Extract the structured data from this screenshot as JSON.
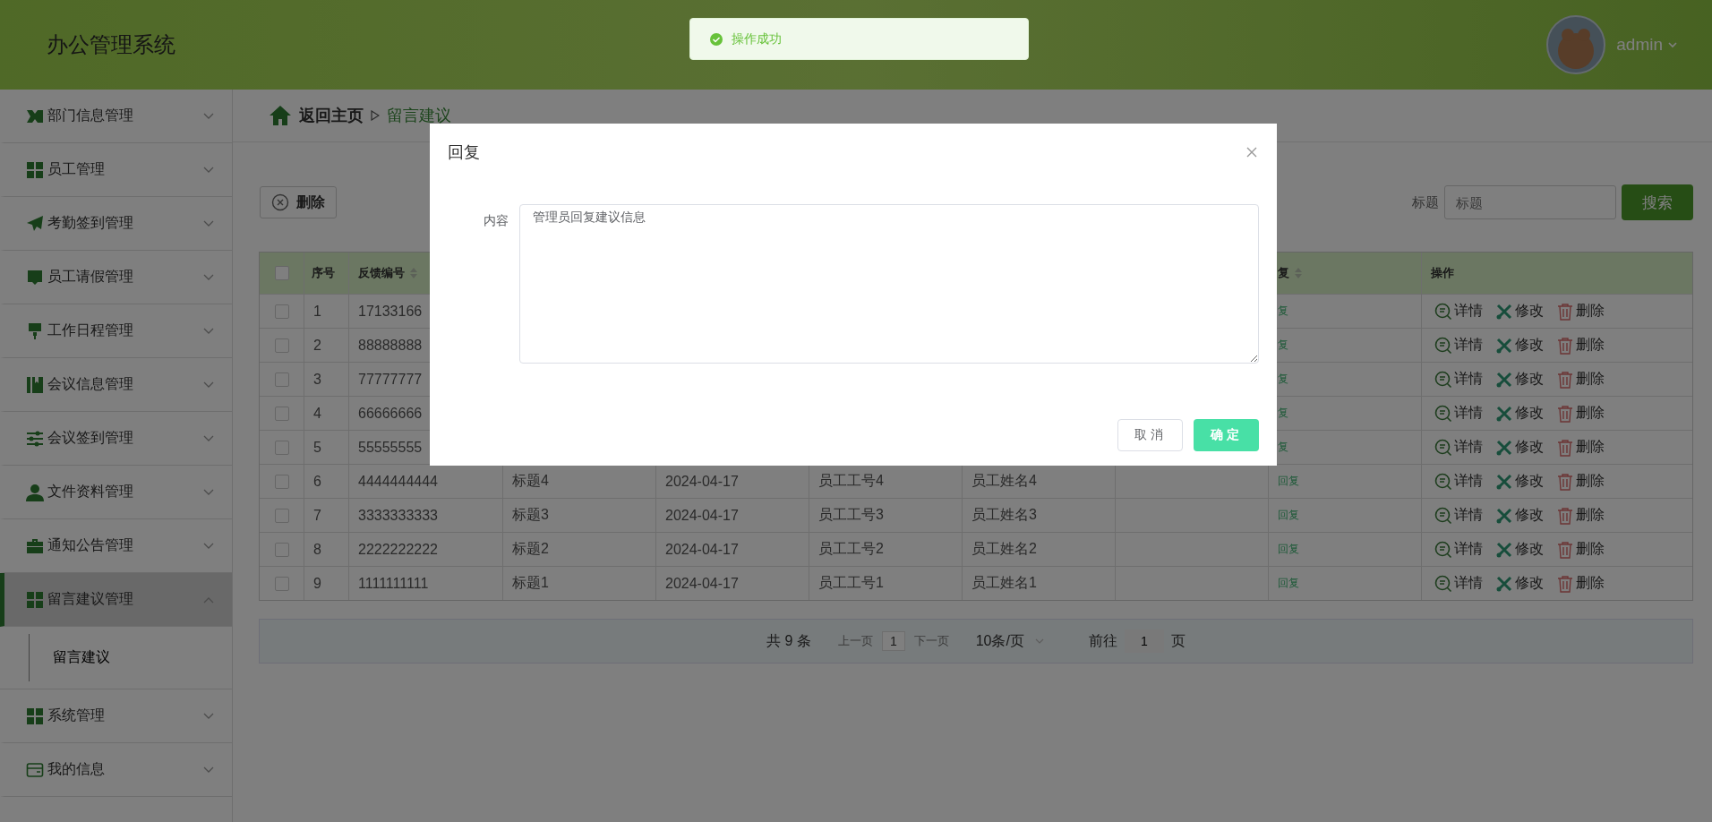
{
  "header": {
    "title": "办公管理系统",
    "user": "admin"
  },
  "toast": {
    "message": "操作成功"
  },
  "sidebar": {
    "items": [
      {
        "label": "部门信息管理",
        "expanded": false,
        "selected": false
      },
      {
        "label": "员工管理",
        "expanded": false,
        "selected": false
      },
      {
        "label": "考勤签到管理",
        "expanded": false,
        "selected": false
      },
      {
        "label": "员工请假管理",
        "expanded": false,
        "selected": false
      },
      {
        "label": "工作日程管理",
        "expanded": false,
        "selected": false
      },
      {
        "label": "会议信息管理",
        "expanded": false,
        "selected": false
      },
      {
        "label": "会议签到管理",
        "expanded": false,
        "selected": false
      },
      {
        "label": "文件资料管理",
        "expanded": false,
        "selected": false
      },
      {
        "label": "通知公告管理",
        "expanded": false,
        "selected": false
      },
      {
        "label": "留言建议管理",
        "expanded": true,
        "selected": true,
        "children": [
          {
            "label": "留言建议",
            "selected": true
          }
        ]
      },
      {
        "label": "系统管理",
        "expanded": false,
        "selected": false
      },
      {
        "label": "我的信息",
        "expanded": false,
        "selected": false
      }
    ]
  },
  "breadcrumb": {
    "home": "返回主页",
    "current": "留言建议"
  },
  "toolbar": {
    "delete_button": "删除",
    "search_label": "标题",
    "search_placeholder": "标题",
    "search_button": "搜索"
  },
  "table": {
    "select_all": {
      "checked": false
    },
    "columns": [
      {
        "label": "序号",
        "kind": "text"
      },
      {
        "label": "反馈编号",
        "kind": "text",
        "sortable": true
      },
      {},
      {},
      {},
      {},
      {},
      {
        "label": "复",
        "kind": "link",
        "sortable": true
      },
      {
        "label": "操作",
        "kind": "actions"
      }
    ],
    "rows": [
      {
        "checked": false,
        "cells": [
          "1",
          "17133166",
          null,
          null,
          null,
          null,
          null,
          "复",
          [
            "详情",
            "修改",
            "删除"
          ]
        ]
      },
      {
        "checked": false,
        "cells": [
          "2",
          "88888888",
          null,
          null,
          null,
          null,
          null,
          "复",
          [
            "详情",
            "修改",
            "删除"
          ]
        ]
      },
      {
        "checked": false,
        "cells": [
          "3",
          "77777777",
          null,
          null,
          null,
          null,
          null,
          "复",
          [
            "详情",
            "修改",
            "删除"
          ]
        ]
      },
      {
        "checked": false,
        "cells": [
          "4",
          "66666666",
          null,
          null,
          null,
          null,
          null,
          "复",
          [
            "详情",
            "修改",
            "删除"
          ]
        ]
      },
      {
        "checked": false,
        "cells": [
          "5",
          "55555555",
          null,
          null,
          null,
          null,
          null,
          "复",
          [
            "详情",
            "修改",
            "删除"
          ]
        ]
      },
      {
        "checked": false,
        "cells": [
          "6",
          "4444444444",
          "标题4",
          "2024-04-17",
          "员工工号4",
          "员工姓名4",
          null,
          "回复",
          [
            "详情",
            "修改",
            "删除"
          ]
        ]
      },
      {
        "checked": false,
        "cells": [
          "7",
          "3333333333",
          "标题3",
          "2024-04-17",
          "员工工号3",
          "员工姓名3",
          null,
          "回复",
          [
            "详情",
            "修改",
            "删除"
          ]
        ]
      },
      {
        "checked": false,
        "cells": [
          "8",
          "2222222222",
          "标题2",
          "2024-04-17",
          "员工工号2",
          "员工姓名2",
          null,
          "回复",
          [
            "详情",
            "修改",
            "删除"
          ]
        ]
      },
      {
        "checked": false,
        "cells": [
          "9",
          "1111111111",
          "标题1",
          "2024-04-17",
          "员工工号1",
          "员工姓名1",
          null,
          "回复",
          [
            "详情",
            "修改",
            "删除"
          ]
        ]
      }
    ]
  },
  "pagination": {
    "total": "共 9 条",
    "prev": "上一页",
    "page": "1",
    "next": "下一页",
    "page_size": "10条/页",
    "goto_label": "前往",
    "goto_value": "1",
    "goto_suffix": "页"
  },
  "dialog": {
    "title": "回复",
    "field_label": "内容",
    "content": "管理员回复建议信息",
    "cancel": "取消",
    "confirm": "确定"
  }
}
